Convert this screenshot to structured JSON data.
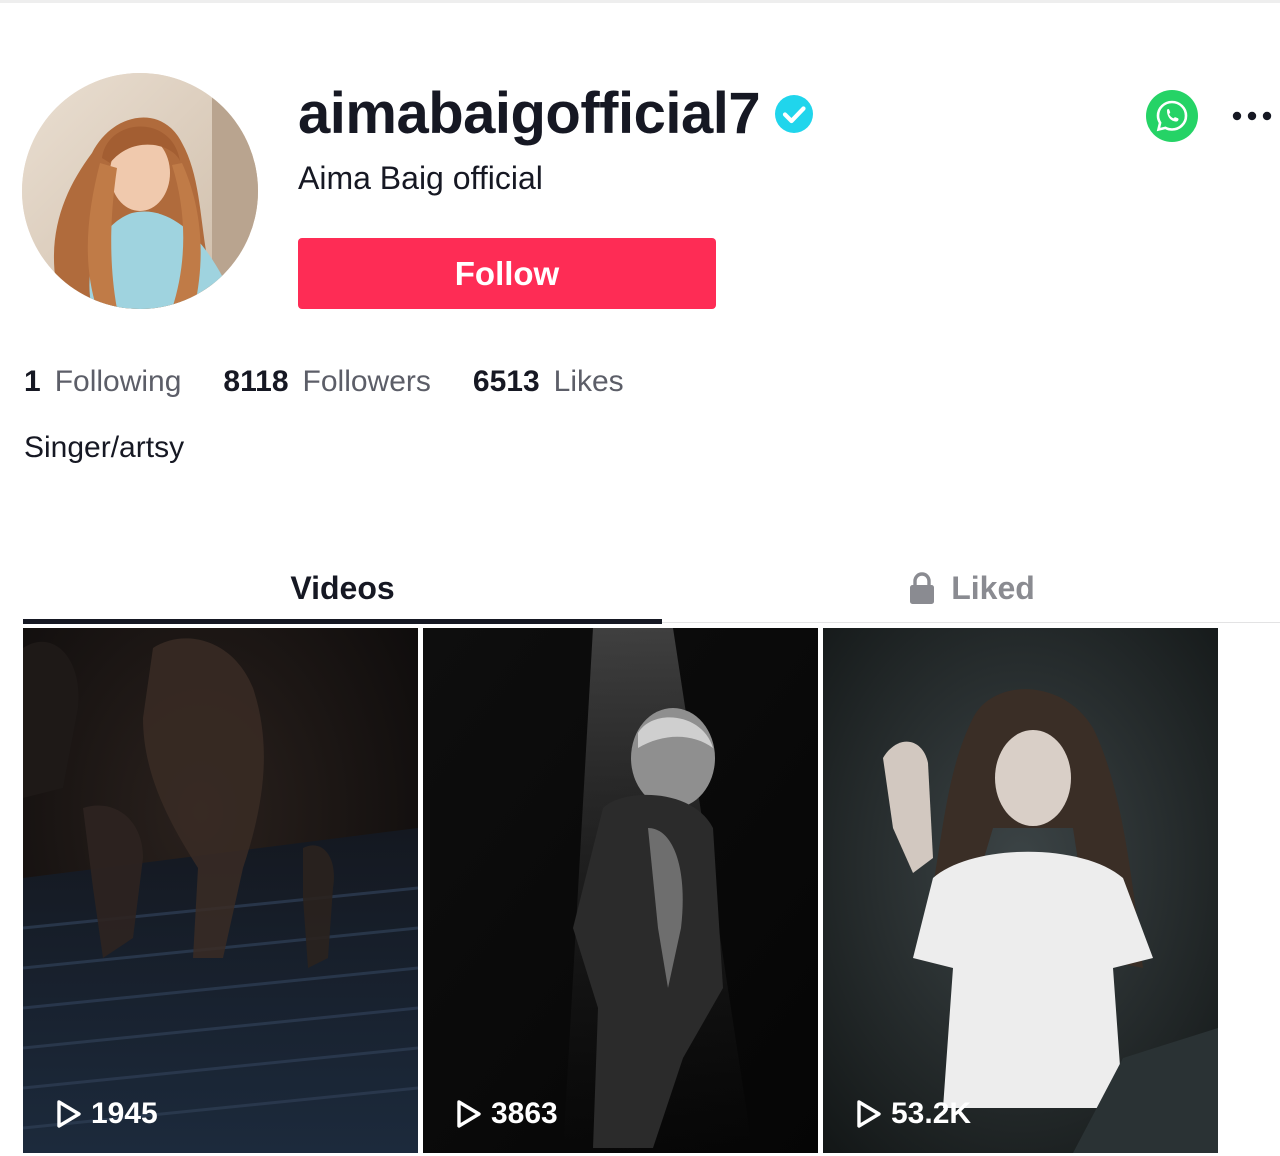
{
  "profile": {
    "username": "aimabaigofficial7",
    "nickname": "Aima Baig official",
    "follow_label": "Follow",
    "bio": "Singer/artsy",
    "verified_icon": "verified-badge-icon",
    "colors": {
      "follow": "#fe2c55",
      "verified": "#20d5ec",
      "whatsapp": "#25d366"
    }
  },
  "stats": [
    {
      "value": "1",
      "label": "Following"
    },
    {
      "value": "8118",
      "label": "Followers"
    },
    {
      "value": "6513",
      "label": "Likes"
    }
  ],
  "tabs": [
    {
      "label": "Videos",
      "active": true
    },
    {
      "label": "Liked",
      "active": false,
      "icon": "lock-icon"
    }
  ],
  "videos": [
    {
      "views": "1945"
    },
    {
      "views": "3863"
    },
    {
      "views": "53.2K"
    }
  ]
}
